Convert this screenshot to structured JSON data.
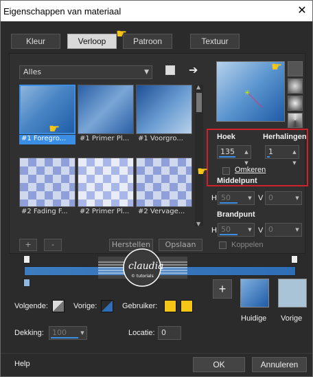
{
  "window": {
    "title": "Eigenschappen van materiaal",
    "close": "✕"
  },
  "tabs": [
    {
      "label": "Kleur"
    },
    {
      "label": "Verloop"
    },
    {
      "label": "Patroon"
    },
    {
      "label": "Textuur"
    }
  ],
  "active_tab": "Verloop",
  "library": {
    "filter_value": "Alles",
    "items": [
      {
        "label": "#1 Foregro..."
      },
      {
        "label": "#1 Primer Pl..."
      },
      {
        "label": "#1 Voorgro..."
      },
      {
        "label": "#2 Fading F..."
      },
      {
        "label": "#2 Primer Pl..."
      },
      {
        "label": "#2 Vervage..."
      }
    ],
    "selected_index": 0,
    "add_label": "+",
    "remove_label": "-",
    "reset_label": "Herstellen",
    "save_label": "Opslaan"
  },
  "settings": {
    "hoek_label": "Hoek",
    "hoek_value": "135",
    "herhalingen_label": "Herhalingen",
    "herhalingen_value": "1",
    "omkeren_label": "Omkeren",
    "middelpunt_label": "Middelpunt",
    "h_label": "H",
    "v_label": "V",
    "middelpunt_h": "50",
    "middelpunt_v": "0",
    "brandpunt_label": "Brandpunt",
    "brandpunt_h": "50",
    "brandpunt_v": "0",
    "koppelen_label": "Koppelen"
  },
  "watermark": {
    "text": "claudia",
    "subtext": "© tutorials"
  },
  "editor": {
    "volgende_label": "Volgende:",
    "vorige_label": "Vorige:",
    "gebruiker_label": "Gebruiker:",
    "dekking_label": "Dekking:",
    "dekking_value": "100",
    "locatie_label": "Locatie:",
    "locatie_value": "0",
    "add_stop_label": "+",
    "huidige_label": "Huidige",
    "vorige_swatch_label": "Vorige"
  },
  "footer": {
    "help_label": "Help",
    "ok_label": "OK",
    "cancel_label": "Annuleren"
  },
  "colors": {
    "accent": "#3b8ee6",
    "user_color": "#f5c518",
    "highlight": "#d0202a",
    "previous_swatch": "#a9c4d6"
  }
}
